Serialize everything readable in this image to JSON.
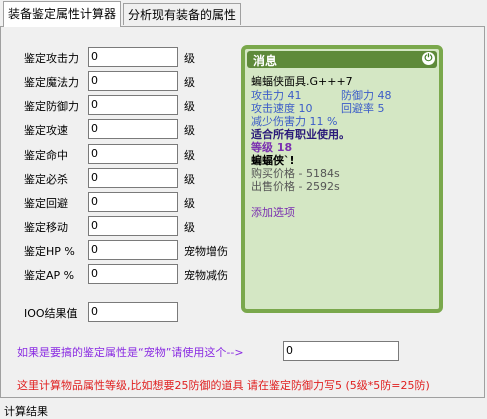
{
  "tabs": [
    {
      "label": "装备鉴定属性计算器"
    },
    {
      "label": "分析现有装备的属性"
    }
  ],
  "rows": [
    {
      "label": "鉴定攻击力",
      "value": "0",
      "suffix": "级"
    },
    {
      "label": "鉴定魔法力",
      "value": "0",
      "suffix": "级"
    },
    {
      "label": "鉴定防御力",
      "value": "0",
      "suffix": "级"
    },
    {
      "label": "鉴定攻速",
      "value": "0",
      "suffix": "级"
    },
    {
      "label": "鉴定命中",
      "value": "0",
      "suffix": "级"
    },
    {
      "label": "鉴定必杀",
      "value": "0",
      "suffix": "级"
    },
    {
      "label": "鉴定回避",
      "value": "0",
      "suffix": "级"
    },
    {
      "label": "鉴定移动",
      "value": "0",
      "suffix": "级"
    },
    {
      "label": "鉴定HP %",
      "value": "0",
      "suffix": "宠物增伤"
    },
    {
      "label": "鉴定AP %",
      "value": "0",
      "suffix": "宠物减伤"
    }
  ],
  "result": {
    "label": "IOO结果值",
    "value": "0"
  },
  "tooltip": {
    "title": "消息",
    "item_name": "蝙蝠侠面具.G+++7",
    "stat1": "攻击力 41",
    "stat1b": "防御力 48",
    "stat2": "攻击速度 10",
    "stat2b": "回避率 5",
    "stat3": "减少伤害力 11 %",
    "restriction": "适合所有职业使用。",
    "level": "等级 18",
    "set_name": "蝙蝠侠`!",
    "buy_price": "购买价格 - 5184s",
    "sell_price": "出售价格 - 2592s",
    "add_option": "添加选项"
  },
  "pet_question": {
    "label": "如果是要搞的鉴定属性是“宠物”请使用这个-->",
    "value": "0"
  },
  "note": "这里计算物品属性等级,比如想要25防御的道具 请在鉴定防御力写5 (5级*5防=25防)",
  "status": "计算结果"
}
